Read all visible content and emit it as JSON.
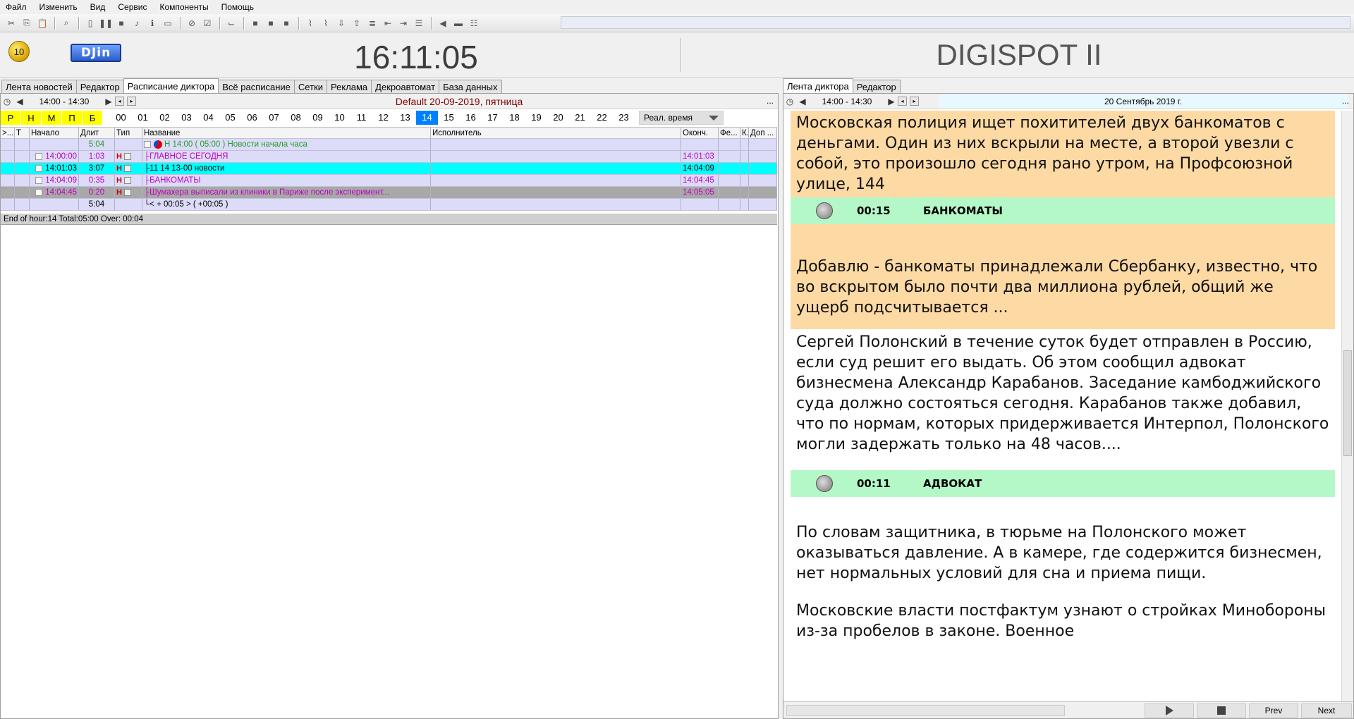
{
  "menu": [
    "Файл",
    "Изменить",
    "Вид",
    "Сервис",
    "Компоненты",
    "Помощь"
  ],
  "header": {
    "badge": "10",
    "logo_text": "DJin",
    "clock": "16:11:05",
    "brand": "DIGISPOT II"
  },
  "left_tabs": [
    {
      "label": "Лента новостей",
      "active": false
    },
    {
      "label": "Редактор",
      "active": false
    },
    {
      "label": "Расписание диктора",
      "active": true
    },
    {
      "label": "Всё расписание",
      "active": false
    },
    {
      "label": "Сетки",
      "active": false
    },
    {
      "label": "Реклама",
      "active": false
    },
    {
      "label": "Декроавтомат",
      "active": false
    },
    {
      "label": "База данных",
      "active": false
    }
  ],
  "right_tabs": [
    {
      "label": "Лента диктора",
      "active": true
    },
    {
      "label": "Редактор",
      "active": false
    }
  ],
  "schedule": {
    "range": "14:00 - 14:30",
    "title": "Default 20-09-2019, пятница",
    "more": "...",
    "letters": [
      "Р",
      "Н",
      "М",
      "П",
      "Б"
    ],
    "hours": [
      "00",
      "01",
      "02",
      "03",
      "04",
      "05",
      "06",
      "07",
      "08",
      "09",
      "10",
      "11",
      "12",
      "13",
      "14",
      "15",
      "16",
      "17",
      "18",
      "19",
      "20",
      "21",
      "22",
      "23"
    ],
    "active_hour": "14",
    "time_mode": "Реал. время",
    "columns": [
      ">...",
      "Т",
      "Начало",
      "Длит",
      "Тип",
      "Название",
      "Исполнитель",
      "Оконч.",
      "Фе...",
      "К...",
      "Доп ..."
    ],
    "rows": [
      {
        "start": "",
        "dur": "5:04",
        "title": "Н 14:00 ( 05:00 ) Новости начала часа",
        "end": ""
      },
      {
        "start": "14:00:00",
        "dur": "1:03",
        "type": "Н",
        "title": "ГЛАВНОЕ СЕГОДНЯ",
        "end": "14:01:03"
      },
      {
        "start": "14:01:03",
        "dur": "3:07",
        "type": "Н",
        "title": "11 14 13-00 новости",
        "end": "14:04:09"
      },
      {
        "start": "14:04:09",
        "dur": "0:35",
        "type": "Н",
        "title": "БАНКОМАТЫ",
        "end": "14:04:45"
      },
      {
        "start": "14:04:45",
        "dur": "0:20",
        "type": "Н",
        "title": "Шумахера выписали из клиники в Париже после эксперимент...",
        "end": "14:05:05"
      },
      {
        "start": "",
        "dur": "5:04",
        "title": "< + 00:05 > ( +00:05 )",
        "end": ""
      }
    ],
    "status": "End of hour:14 Total:05:00 Over: 00:04"
  },
  "announcer": {
    "range": "14:00 - 14:30",
    "date": "20 Сентябрь 2019 г.",
    "more": "...",
    "p1": "Московская полиция ищет похитителей двух банкоматов с деньгами. Один из них вскрыли на месте, а второй увезли с собой, это произошло сегодня рано утром, на Профсоюзной улице, 144",
    "a1_dur": "00:15",
    "a1_title": "БАНКОМАТЫ",
    "p2": "Добавлю - банкоматы принадлежали Сбербанку, известно, что во вскрытом было почти два миллиона рублей, общий же ущерб подсчитывается ...",
    "p3": "Сергей Полонский в течение суток будет отправлен в Россию, если суд решит его выдать. Об этом сообщил адвокат бизнесмена Александр Карабанов. Заседание камбоджийского суда должно состояться сегодня. Карабанов также добавил, что по нормам, которых придерживается Интерпол, Полонского могли задержать только на 48 часов....",
    "a2_dur": "00:11",
    "a2_title": "АДВОКАТ",
    "p4": "По словам защитника, в тюрьме на Полонского может оказываться давление. А в камере, где содержится бизнесмен, нет нормальных условий для сна и приема пищи.",
    "p5": "Московские власти постфактум узнают о стройках Минобороны из-за пробелов в законе. Военное",
    "prev": "Prev",
    "next": "Next"
  }
}
